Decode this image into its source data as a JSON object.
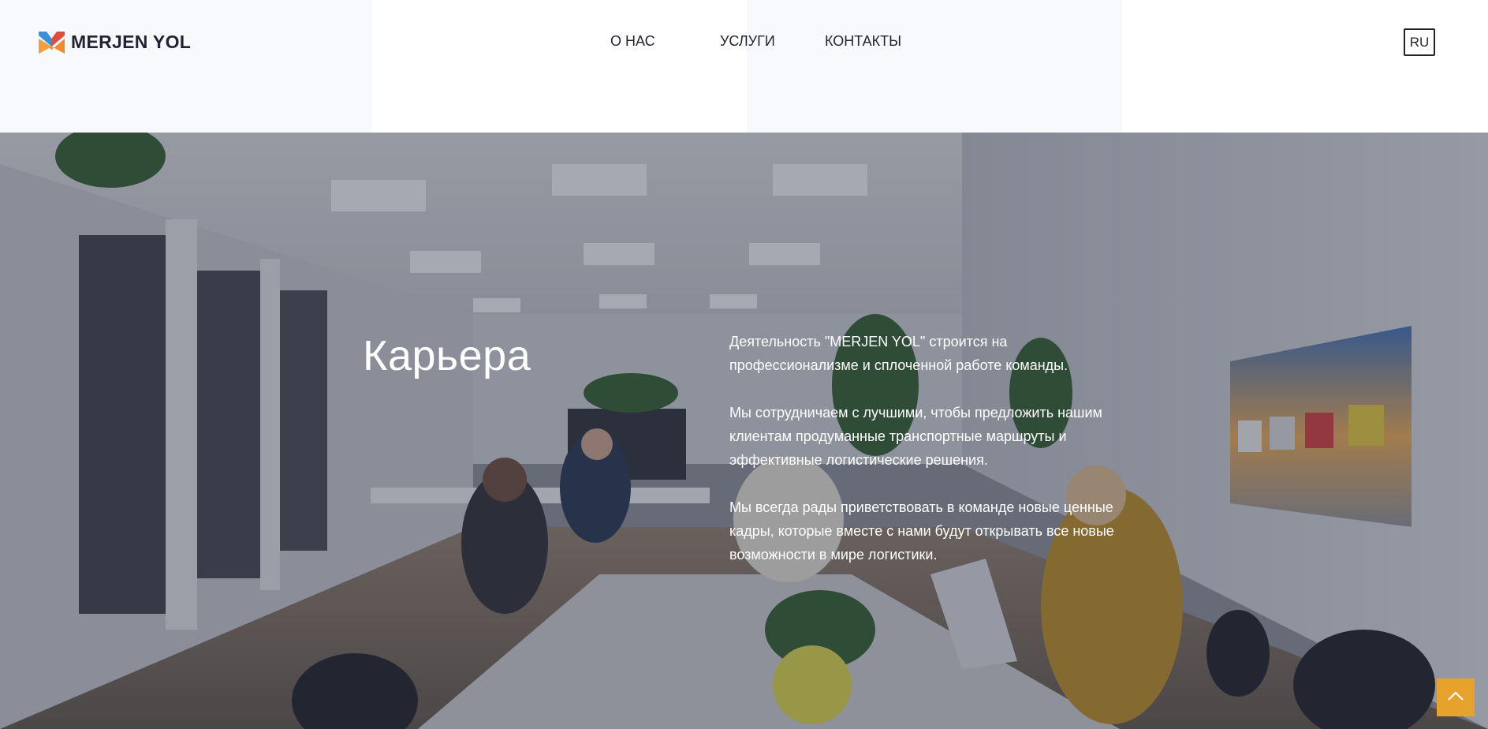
{
  "brand": {
    "name": "MERJEN YOL",
    "logo_icon": "merjen-yol-logo-icon",
    "colors": {
      "blue": "#3a8fd8",
      "orange": "#f08a2c",
      "red": "#e14b3a"
    }
  },
  "nav": {
    "items": [
      {
        "label": "О НАС"
      },
      {
        "label": "УСЛУГИ"
      },
      {
        "label": "КОНТАКТЫ"
      }
    ]
  },
  "language": {
    "current": "RU"
  },
  "hero": {
    "title": "Карьера",
    "paragraphs": [
      "Деятельность \"MERJEN YOL\" строится на профессионализме и сплоченной работе команды.",
      "Мы сотрудничаем с лучшими, чтобы предложить нашим клиентам продуманные транспортные маршруты и эффективные логистические решения.",
      "Мы всегда рады приветствовать в команде новые ценные кадры, которые вместе с нами будут открывать все новые возможности в мире логистики."
    ],
    "background": "office-photo"
  },
  "scroll_top": {
    "icon": "chevron-up-icon",
    "color": "#e7a22b"
  }
}
